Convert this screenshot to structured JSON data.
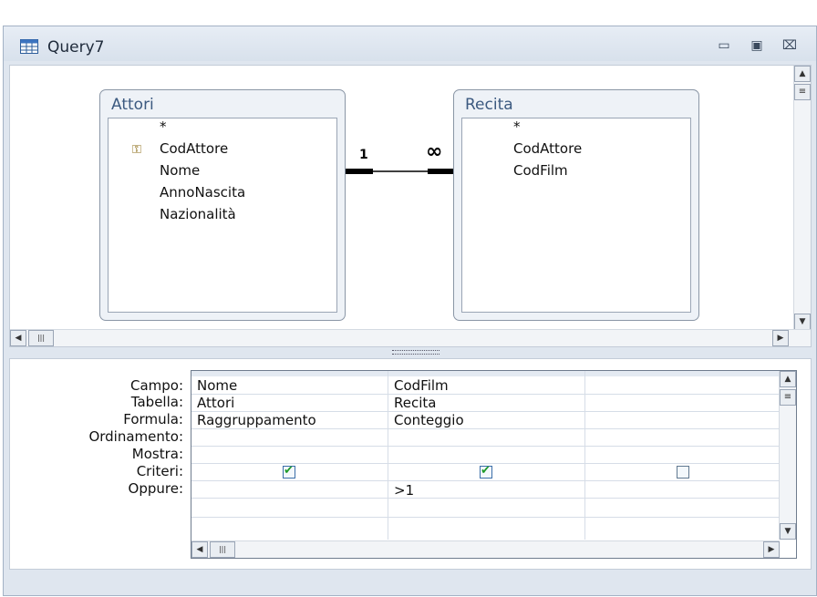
{
  "window": {
    "title": "Query7"
  },
  "tables": [
    {
      "title": "Attori",
      "fields": [
        "*",
        "CodAttore",
        "Nome",
        "AnnoNascita",
        "Nazionalità"
      ],
      "key_field": "CodAttore"
    },
    {
      "title": "Recita",
      "fields": [
        "*",
        "CodAttore",
        "CodFilm"
      ]
    }
  ],
  "relationship": {
    "one_label": "1",
    "many_label": "∞"
  },
  "grid": {
    "row_labels": [
      "Campo:",
      "Tabella:",
      "Formula:",
      "Ordinamento:",
      "Mostra:",
      "Criteri:",
      "Oppure:"
    ],
    "columns": [
      {
        "campo": "Nome",
        "tabella": "Attori",
        "formula": "Raggruppamento",
        "mostra": true,
        "criteri": ""
      },
      {
        "campo": "CodFilm",
        "tabella": "Recita",
        "formula": "Conteggio",
        "mostra": true,
        "criteri": ">1"
      },
      {
        "campo": "",
        "tabella": "",
        "formula": "",
        "mostra": false,
        "criteri": ""
      }
    ]
  },
  "icons": {
    "app": "query-datasheet-icon",
    "key": "primary-key-icon",
    "minimize": "minimize-icon",
    "restore": "restore-icon",
    "close": "close-icon"
  }
}
